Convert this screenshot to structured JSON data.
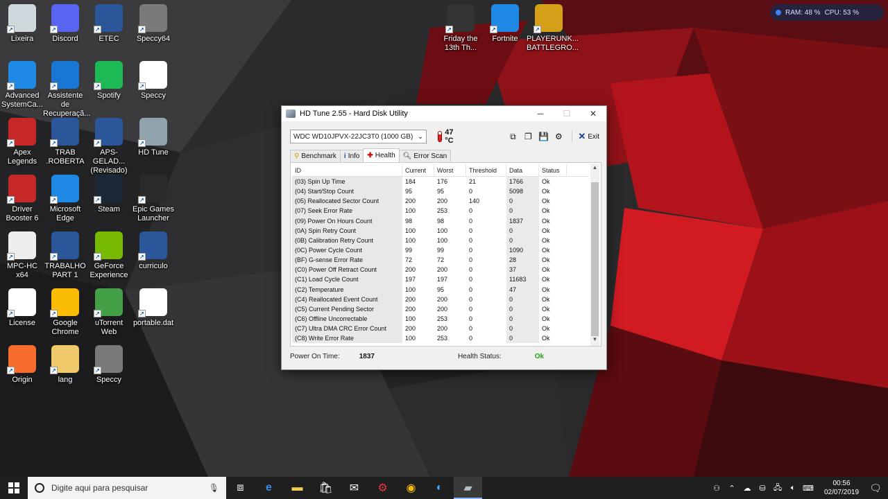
{
  "desktop": {
    "icons": [
      {
        "label": "Lixeira",
        "icon": "recycle-bin-icon",
        "color": "#cfd8dc"
      },
      {
        "label": "Discord",
        "icon": "discord-icon",
        "color": "#5865f2"
      },
      {
        "label": "ETEC",
        "icon": "word-doc-icon",
        "color": "#2b579a"
      },
      {
        "label": "Speccy64",
        "icon": "speccy-icon",
        "color": "#7a7a7a"
      },
      {
        "label": "Advanced SystemCa...",
        "icon": "advanced-systemcare-icon",
        "color": "#1e88e5"
      },
      {
        "label": "Assistente de Recuperaçã...",
        "icon": "recovery-assistant-icon",
        "color": "#1976d2"
      },
      {
        "label": "Spotify",
        "icon": "spotify-icon",
        "color": "#1db954"
      },
      {
        "label": "Speccy",
        "icon": "speccy-file-icon",
        "color": "#ffffff"
      },
      {
        "label": "Apex Legends",
        "icon": "apex-legends-icon",
        "color": "#c62828"
      },
      {
        "label": "TRAB .ROBERTA",
        "icon": "word-doc-icon",
        "color": "#2b579a"
      },
      {
        "label": "APS-GELAD... (Revisado)",
        "icon": "word-doc-icon",
        "color": "#2b579a"
      },
      {
        "label": "HD Tune",
        "icon": "hd-tune-icon",
        "color": "#90a4ae"
      },
      {
        "label": "Driver Booster 6",
        "icon": "driver-booster-icon",
        "color": "#c62828"
      },
      {
        "label": "Microsoft Edge",
        "icon": "edge-icon",
        "color": "#1e88e5"
      },
      {
        "label": "Steam",
        "icon": "steam-icon",
        "color": "#1b2838"
      },
      {
        "label": "Epic Games Launcher",
        "icon": "epic-games-icon",
        "color": "#2a2a2a"
      },
      {
        "label": "MPC-HC x64",
        "icon": "mpc-hc-icon",
        "color": "#eeeeee"
      },
      {
        "label": "TRABALHO PART 1",
        "icon": "word-doc-icon",
        "color": "#2b579a"
      },
      {
        "label": "GeForce Experience",
        "icon": "geforce-icon",
        "color": "#76b900"
      },
      {
        "label": "curriculo",
        "icon": "word-doc-icon",
        "color": "#2b579a"
      },
      {
        "label": "License",
        "icon": "text-file-icon",
        "color": "#ffffff"
      },
      {
        "label": "Google Chrome",
        "icon": "chrome-icon",
        "color": "#fbbc05"
      },
      {
        "label": "uTorrent Web",
        "icon": "utorrent-icon",
        "color": "#43a047"
      },
      {
        "label": "portable.dat",
        "icon": "blank-file-icon",
        "color": "#ffffff"
      },
      {
        "label": "Origin",
        "icon": "origin-icon",
        "color": "#f56c2d"
      },
      {
        "label": "lang",
        "icon": "folder-icon",
        "color": "#f0c96b"
      },
      {
        "label": "Speccy",
        "icon": "speccy-icon",
        "color": "#7a7a7a"
      }
    ],
    "top_icons": [
      {
        "label": "Friday the 13th Th...",
        "icon": "friday-13th-icon",
        "color": "#333333"
      },
      {
        "label": "Fortnite",
        "icon": "fortnite-icon",
        "color": "#1e88e5"
      },
      {
        "label": "PLAYERUNK... BATTLEGRO...",
        "icon": "pubg-icon",
        "color": "#d4a017"
      }
    ],
    "perf": {
      "ram": "RAM: 48 %",
      "cpu": "CPU: 53 %"
    }
  },
  "window": {
    "title": "HD Tune 2.55 - Hard Disk Utility",
    "drive": "WDC    WD10JPVX-22JC3T0 (1000 GB)",
    "temperature": "47 °C",
    "exit_label": "Exit",
    "tabs": [
      {
        "label": "Benchmark",
        "icon": "benchmark-icon"
      },
      {
        "label": "Info",
        "icon": "info-icon"
      },
      {
        "label": "Health",
        "icon": "health-icon"
      },
      {
        "label": "Error Scan",
        "icon": "error-scan-icon"
      }
    ],
    "columns": [
      "ID",
      "Current",
      "Worst",
      "Threshold",
      "Data",
      "Status"
    ],
    "rows": [
      [
        "(03) Spin Up Time",
        "184",
        "176",
        "21",
        "1766",
        "Ok"
      ],
      [
        "(04) Start/Stop Count",
        "95",
        "95",
        "0",
        "5098",
        "Ok"
      ],
      [
        "(05) Reallocated Sector Count",
        "200",
        "200",
        "140",
        "0",
        "Ok"
      ],
      [
        "(07) Seek Error Rate",
        "100",
        "253",
        "0",
        "0",
        "Ok"
      ],
      [
        "(09) Power On Hours Count",
        "98",
        "98",
        "0",
        "1837",
        "Ok"
      ],
      [
        "(0A) Spin Retry Count",
        "100",
        "100",
        "0",
        "0",
        "Ok"
      ],
      [
        "(0B) Calibration Retry Count",
        "100",
        "100",
        "0",
        "0",
        "Ok"
      ],
      [
        "(0C) Power Cycle Count",
        "99",
        "99",
        "0",
        "1090",
        "Ok"
      ],
      [
        "(BF) G-sense Error Rate",
        "72",
        "72",
        "0",
        "28",
        "Ok"
      ],
      [
        "(C0) Power Off Retract Count",
        "200",
        "200",
        "0",
        "37",
        "Ok"
      ],
      [
        "(C1) Load Cycle Count",
        "197",
        "197",
        "0",
        "11683",
        "Ok"
      ],
      [
        "(C2) Temperature",
        "100",
        "95",
        "0",
        "47",
        "Ok"
      ],
      [
        "(C4) Reallocated Event Count",
        "200",
        "200",
        "0",
        "0",
        "Ok"
      ],
      [
        "(C5) Current Pending Sector",
        "200",
        "200",
        "0",
        "0",
        "Ok"
      ],
      [
        "(C6) Offline Uncorrectable",
        "100",
        "253",
        "0",
        "0",
        "Ok"
      ],
      [
        "(C7) Ultra DMA CRC Error Count",
        "200",
        "200",
        "0",
        "0",
        "Ok"
      ],
      [
        "(C8) Write Error Rate",
        "100",
        "253",
        "0",
        "0",
        "Ok"
      ]
    ],
    "footer": {
      "power_on_label": "Power On Time:",
      "power_on_value": "1837",
      "health_label": "Health Status:",
      "health_value": "Ok"
    }
  },
  "taskbar": {
    "search_placeholder": "Digite aqui para pesquisar",
    "apps": [
      "task-view-icon",
      "edge-icon",
      "file-explorer-icon",
      "store-icon",
      "mail-icon",
      "driver-booster-icon",
      "chrome-icon",
      "advanced-systemcare-icon",
      "hd-tune-icon"
    ],
    "time": "00:56",
    "date": "02/07/2019"
  }
}
